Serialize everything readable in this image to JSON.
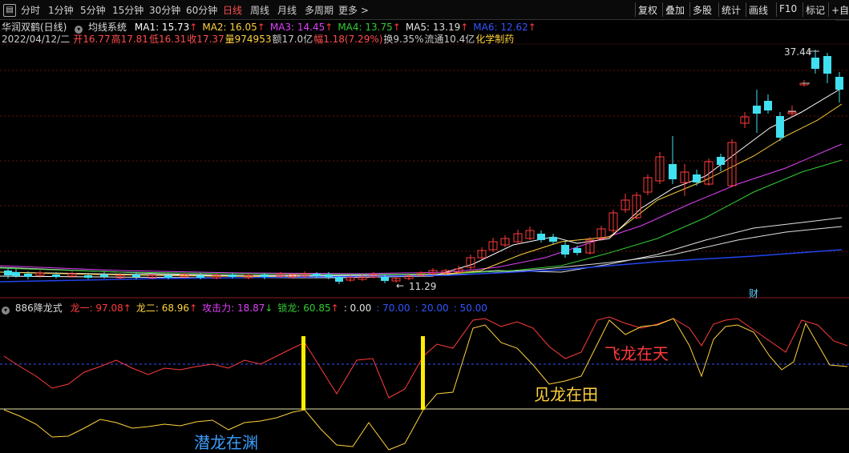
{
  "toolbar": {
    "periods": [
      "分时",
      "1分钟",
      "5分钟",
      "15分钟",
      "30分钟",
      "60分钟",
      "日线",
      "周线",
      "月线",
      "多周期",
      "更多 >"
    ],
    "active_period": "日线",
    "right_buttons": [
      "复权",
      "叠加",
      "多股",
      "统计",
      "画线",
      "F10",
      "标记",
      "+自选"
    ]
  },
  "header": {
    "stock_name": "华润双鹤(日线)",
    "indicator_name": "均线系统",
    "ma": [
      {
        "label": "MA1: 15.73",
        "arrow": "↑",
        "color": "#ffffff"
      },
      {
        "label": "MA2: 16.05",
        "arrow": "↑",
        "color": "#ffd23c"
      },
      {
        "label": "MA3: 14.45",
        "arrow": "↑",
        "color": "#e040fb"
      },
      {
        "label": "MA4: 13.75",
        "arrow": "↑",
        "color": "#33cc33"
      },
      {
        "label": "MA5: 13.19",
        "arrow": "↑",
        "color": "#e0e0e0"
      },
      {
        "label": "MA6: 12.62",
        "arrow": "↑",
        "color": "#3355ff"
      }
    ],
    "info": [
      {
        "text": "2022/04/12/二",
        "color": "#cccccc"
      },
      {
        "text": "开16.77",
        "color": "#ff4d4d"
      },
      {
        "text": "高17.81",
        "color": "#ff4d4d"
      },
      {
        "text": "低16.31",
        "color": "#ff4d4d"
      },
      {
        "text": "收17.37",
        "color": "#ff4d4d"
      },
      {
        "text": "量974953",
        "color": "#ffd23c"
      },
      {
        "text": "额17.0亿",
        "color": "#cccccc"
      },
      {
        "text": "幅1.18(7.29%)",
        "color": "#ff4d4d"
      },
      {
        "text": "换9.35%",
        "color": "#cccccc"
      },
      {
        "text": "流通10.4亿",
        "color": "#cccccc"
      },
      {
        "text": "化学制药",
        "color": "#ffd23c"
      }
    ]
  },
  "price_labels": {
    "high": "37.44",
    "low": "11.29",
    "finance_marker": "财"
  },
  "indicator": {
    "name": "886降龙式",
    "values": [
      {
        "label": "龙一: 97.08",
        "arrow": "↑",
        "color": "#ff3b3b"
      },
      {
        "label": "龙二: 68.96",
        "arrow": "↑",
        "color": "#ffd23c"
      },
      {
        "label": "攻击力: 18.87",
        "arrow": "↓",
        "color": "#e040fb"
      },
      {
        "label": "锁龙: 60.85",
        "arrow": "↑",
        "color": "#33cc33"
      },
      {
        "label": ": 0.00",
        "arrow": "",
        "color": "#e0e0e0"
      },
      {
        "label": ": 70.00",
        "arrow": "",
        "color": "#3355ff"
      },
      {
        "label": ": 20.00",
        "arrow": "",
        "color": "#3355ff"
      },
      {
        "label": ": 50.00",
        "arrow": "",
        "color": "#3355ff"
      }
    ],
    "annotations": {
      "qian_long": "潜龙在渊",
      "jian_long": "见龙在田",
      "fei_long": "飞龙在天"
    }
  },
  "colors": {
    "up": "#ff3b3b",
    "down": "#40e0f0",
    "grid": "#6a1414"
  }
}
